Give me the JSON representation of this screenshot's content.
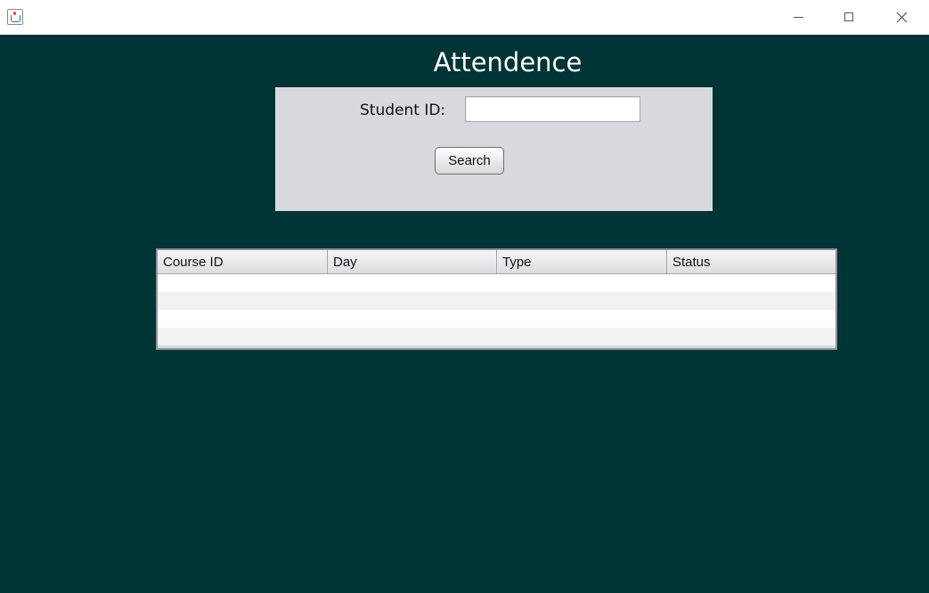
{
  "window": {
    "icon": "java-cup-icon",
    "controls": [
      "minimize-icon",
      "maximize-icon",
      "close-icon"
    ]
  },
  "page": {
    "title": "Attendence"
  },
  "search": {
    "label": "Student ID:",
    "value": "",
    "button_label": "Search"
  },
  "table": {
    "columns": [
      "Course ID",
      "Day",
      "Type",
      "Status"
    ],
    "rows": [
      [],
      [],
      [],
      []
    ]
  },
  "colors": {
    "background": "#013435",
    "panel": "#d7d9de"
  }
}
